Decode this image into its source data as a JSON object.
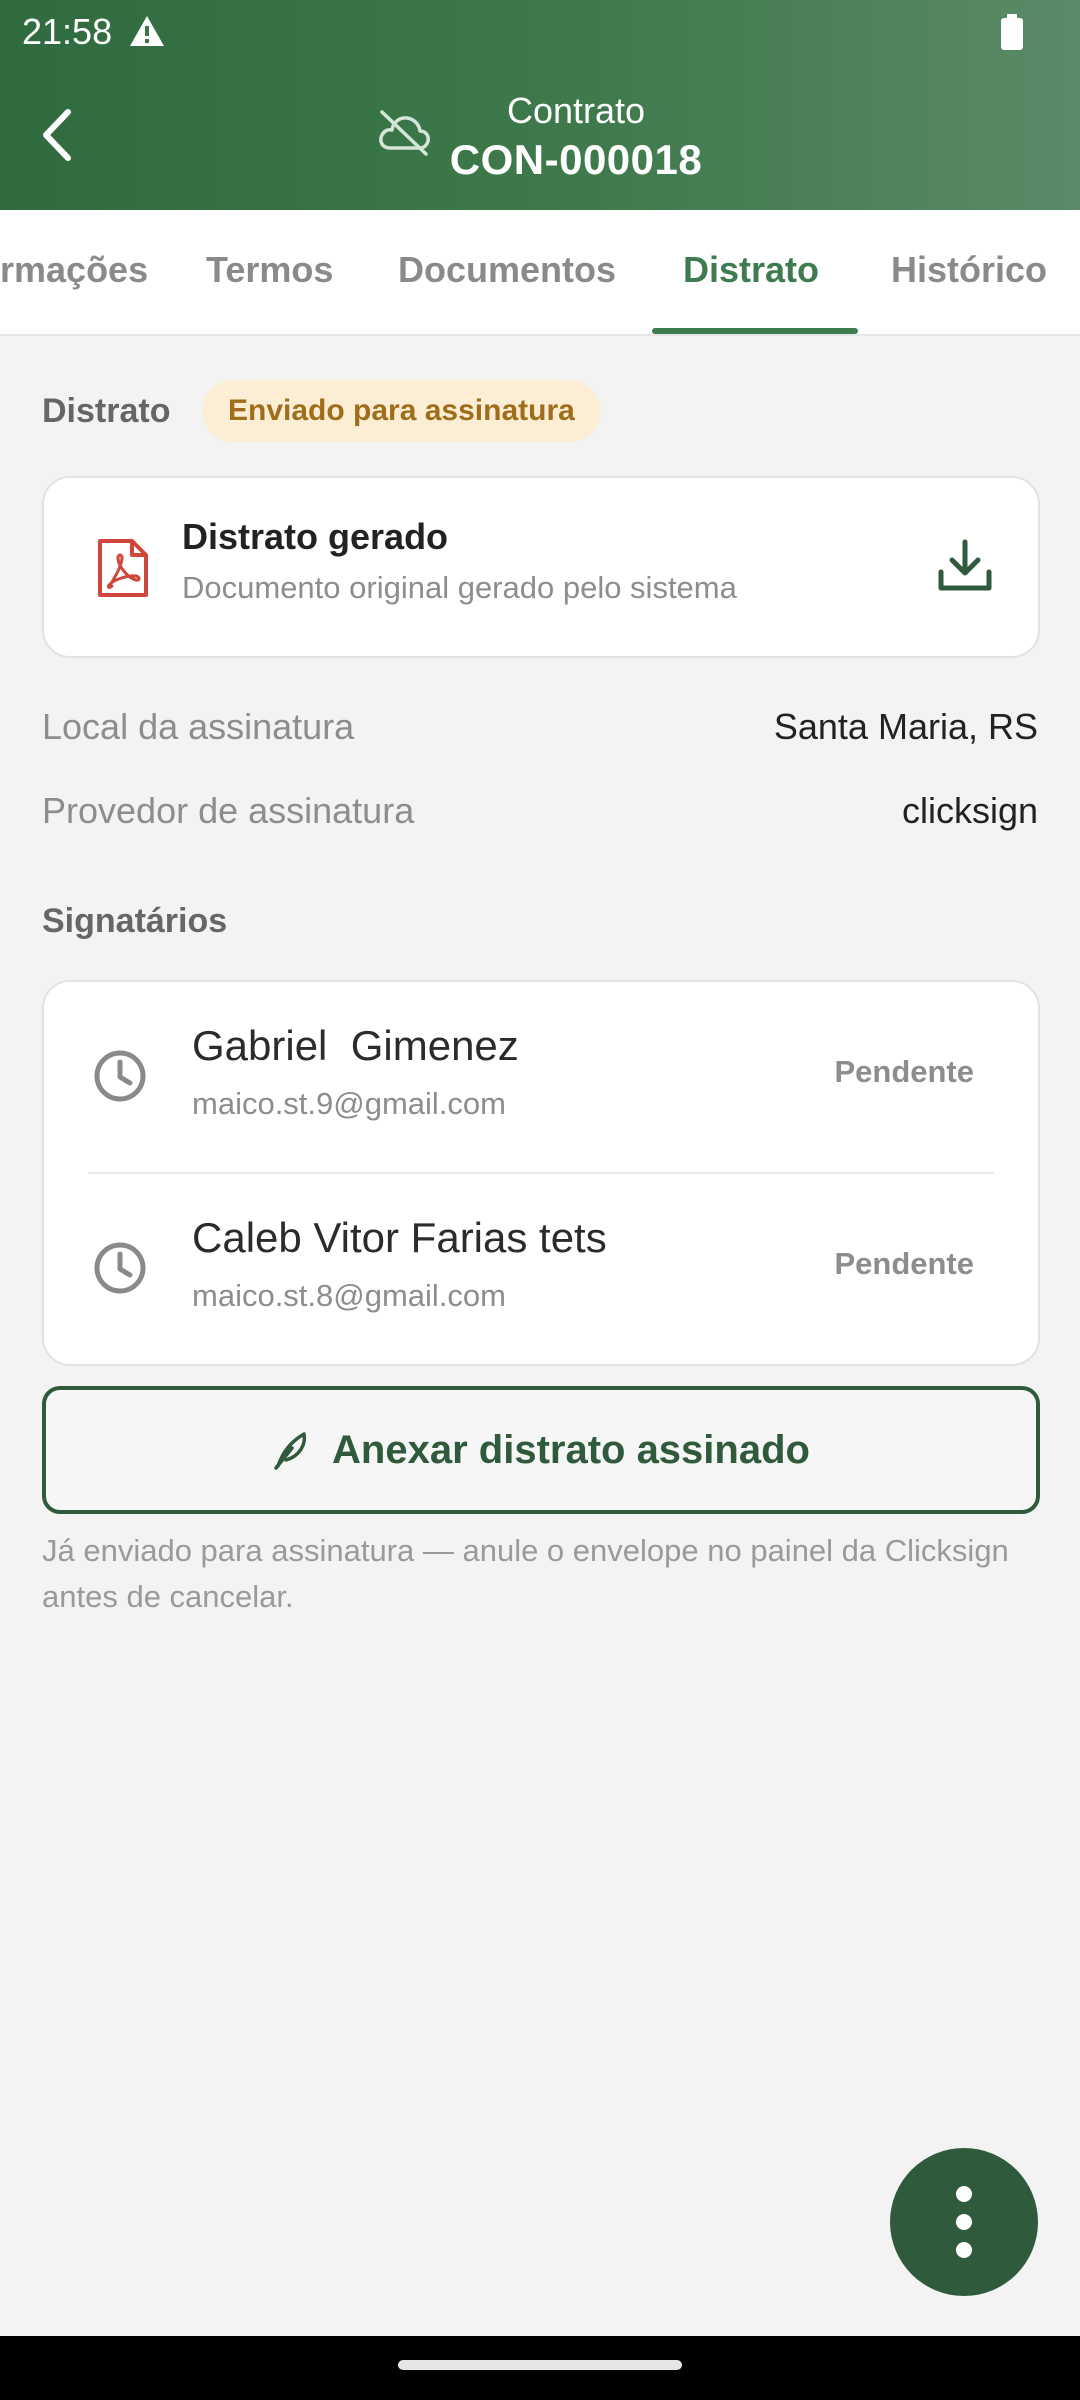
{
  "status_bar": {
    "time": "21:58"
  },
  "header": {
    "subtitle": "Contrato",
    "title": "CON-000018"
  },
  "tabs": [
    {
      "label": "rmações"
    },
    {
      "label": "Termos"
    },
    {
      "label": "Documentos"
    },
    {
      "label": "Distrato",
      "active": true
    },
    {
      "label": "Histórico"
    }
  ],
  "distrato": {
    "section_label": "Distrato",
    "status_badge": "Enviado para assinatura",
    "document": {
      "title": "Distrato gerado",
      "subtitle": "Documento original gerado pelo sistema"
    },
    "info": [
      {
        "label": "Local da assinatura",
        "value": "Santa Maria, RS"
      },
      {
        "label": "Provedor de assinatura",
        "value": "clicksign"
      }
    ],
    "signers_title": "Signatários",
    "signers": [
      {
        "name": "Gabriel  Gimenez",
        "email": "maico.st.9@gmail.com",
        "status": "Pendente"
      },
      {
        "name": "Caleb Vitor Farias tets",
        "email": "maico.st.8@gmail.com",
        "status": "Pendente"
      }
    ],
    "attach_button": "Anexar distrato assinado",
    "note": "Já enviado para assinatura — anule o envelope no painel da Clicksign antes de cancelar."
  },
  "colors": {
    "header_green": "#3f7a4c",
    "accent_green": "#3e7b4e",
    "dark_green": "#2f5a3c",
    "badge_bg": "#fbeed4",
    "badge_text": "#a06e1a",
    "pdf_red": "#d0463b"
  },
  "icons": [
    "warning-icon",
    "battery-icon",
    "back-arrow-icon",
    "cloud-off-icon",
    "pdf-icon",
    "download-icon",
    "clock-icon",
    "feather-icon",
    "more-vert-icon"
  ]
}
